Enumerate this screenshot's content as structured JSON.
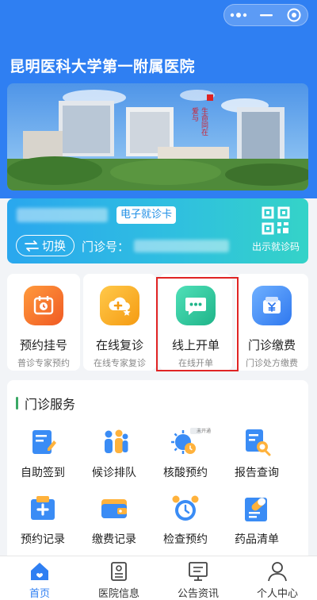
{
  "header": {
    "title": "昆明医科大学第一附属医院"
  },
  "banner": {
    "image": "hospital-campus-photo",
    "calligraphy": "爱与生命同在"
  },
  "patient_card": {
    "tag": "电子就诊卡",
    "switch_label": "切换",
    "outpatient_label": "门诊号：",
    "qr_label": "出示就诊码"
  },
  "quick_actions": [
    {
      "label": "预约挂号",
      "sub": "普诊专家预约",
      "icon": "calendar-clock-icon",
      "color": "#f36a2c"
    },
    {
      "label": "在线复诊",
      "sub": "在线专家复诊",
      "icon": "cloud-plus-icon",
      "color": "#f7a51b"
    },
    {
      "label": "线上开单",
      "sub": "在线开单",
      "icon": "chat-dots-icon",
      "color": "#2cc59a"
    },
    {
      "label": "门诊缴费",
      "sub": "门诊处方缴费",
      "icon": "yen-wallet-icon",
      "color": "#3a8cf5"
    }
  ],
  "services": {
    "title": "门诊服务",
    "items": [
      {
        "label": "自助签到",
        "icon": "sign-in-doc-icon"
      },
      {
        "label": "候诊排队",
        "icon": "queue-people-icon"
      },
      {
        "label": "核酸预约",
        "icon": "virus-test-icon",
        "badge": "未开通"
      },
      {
        "label": "报告查询",
        "icon": "report-search-icon"
      },
      {
        "label": "预约记录",
        "icon": "medical-record-icon"
      },
      {
        "label": "缴费记录",
        "icon": "payment-wallet-icon"
      },
      {
        "label": "检查预约",
        "icon": "alarm-clock-icon"
      },
      {
        "label": "药品清单",
        "icon": "medicine-list-icon"
      }
    ]
  },
  "tabbar": [
    {
      "label": "首页",
      "icon": "home-icon",
      "active": true
    },
    {
      "label": "医院信息",
      "icon": "hospital-info-icon",
      "active": false
    },
    {
      "label": "公告资讯",
      "icon": "notice-board-icon",
      "active": false
    },
    {
      "label": "个人中心",
      "icon": "person-icon",
      "active": false
    }
  ],
  "colors": {
    "primary": "#2f7ff2",
    "highlight": "#e02424",
    "accent_green": "#3aa865"
  }
}
